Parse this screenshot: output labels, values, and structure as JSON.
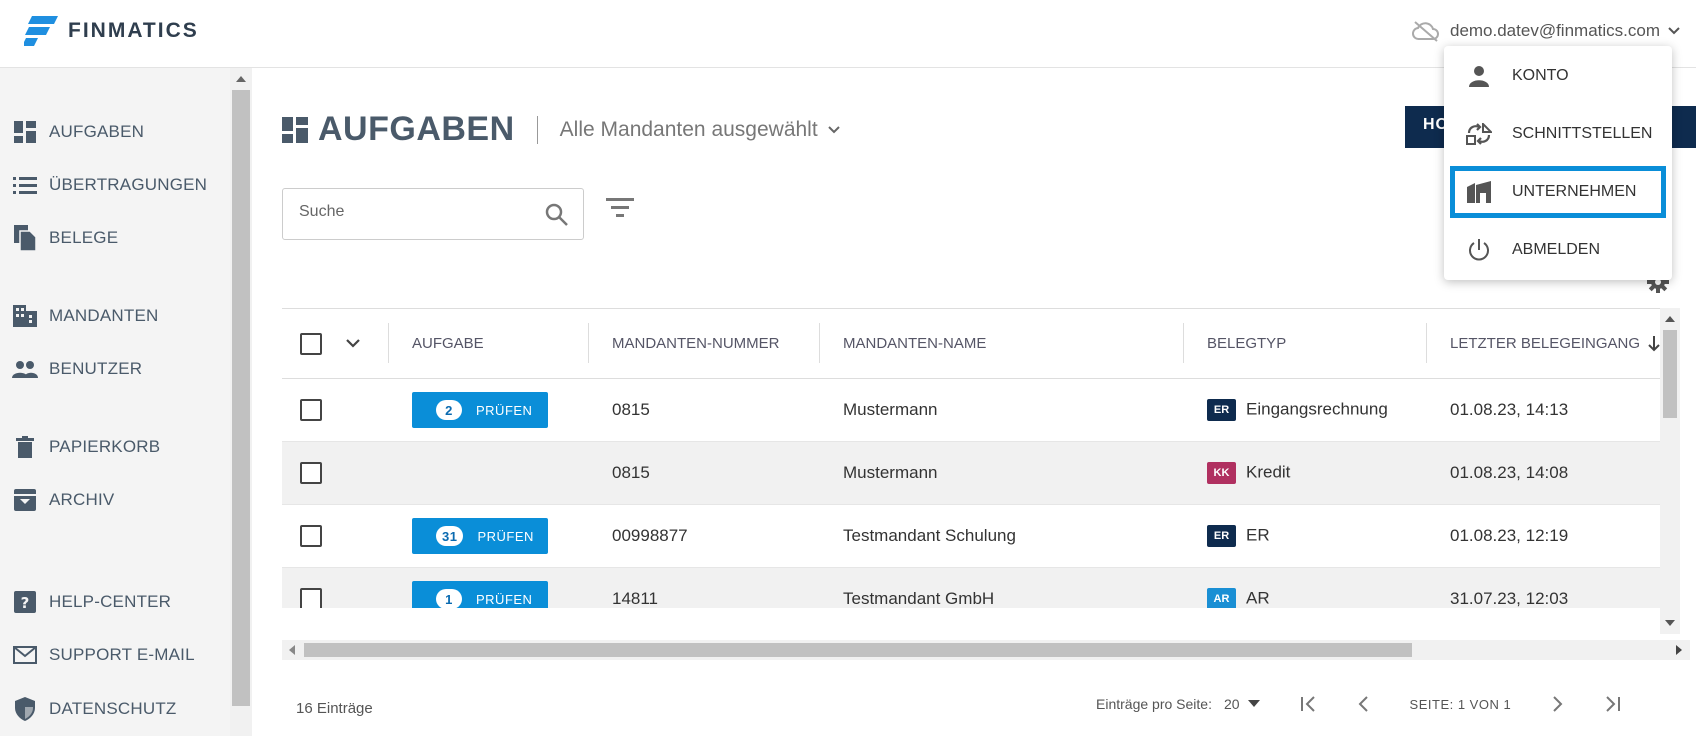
{
  "app": {
    "logo_text": "FINMATICS"
  },
  "user": {
    "email": "demo.datev@finmatics.com"
  },
  "sidebar": {
    "items": [
      {
        "label": "AUFGABEN",
        "icon": "dashboard-icon"
      },
      {
        "label": "ÜBERTRAGUNGEN",
        "icon": "list-icon"
      },
      {
        "label": "BELEGE",
        "icon": "document-copy-icon"
      },
      {
        "label": "MANDANTEN",
        "icon": "building-icon"
      },
      {
        "label": "BENUTZER",
        "icon": "people-icon"
      },
      {
        "label": "PAPIERKORB",
        "icon": "trash-icon"
      },
      {
        "label": "ARCHIV",
        "icon": "archive-icon"
      },
      {
        "label": "HELP-CENTER",
        "icon": "help-icon"
      },
      {
        "label": "SUPPORT E-MAIL",
        "icon": "mail-icon"
      },
      {
        "label": "DATENSCHUTZ",
        "icon": "shield-icon"
      }
    ]
  },
  "header": {
    "title": "AUFGABEN",
    "mandant_select": "Alle Mandanten ausgewählt",
    "primary_button": "HO"
  },
  "search": {
    "placeholder": "Suche"
  },
  "table": {
    "columns": [
      "AUFGABE",
      "MANDANTEN-NUMMER",
      "MANDANTEN-NAME",
      "BELEGTYP",
      "LETZTER BELEGEINGANG"
    ],
    "action_label": "PRÜFEN",
    "rows": [
      {
        "count": "2",
        "number": "0815",
        "name": "Mustermann",
        "tag": "ER",
        "tag_color": "#0e2b4e",
        "type": "Eingangsrechnung",
        "date": "01.08.23, 14:13"
      },
      {
        "count": "",
        "number": "0815",
        "name": "Mustermann",
        "tag": "KK",
        "tag_color": "#b03060",
        "type": "Kredit",
        "date": "01.08.23, 14:08"
      },
      {
        "count": "31",
        "number": "00998877",
        "name": "Testmandant Schulung",
        "tag": "ER",
        "tag_color": "#0e2b4e",
        "type": "ER",
        "date": "01.08.23, 12:19"
      },
      {
        "count": "1",
        "number": "14811",
        "name": "Testmandant GmbH",
        "tag": "AR",
        "tag_color": "#1a8fd4",
        "type": "AR",
        "date": "31.07.23, 12:03"
      }
    ]
  },
  "footer": {
    "entries": "16 Einträge",
    "per_page_label": "Einträge pro Seite:",
    "per_page_value": "20",
    "page_text": "SEITE: 1 VON 1"
  },
  "user_menu": {
    "items": [
      {
        "label": "KONTO",
        "icon": "person-icon"
      },
      {
        "label": "SCHNITTSTELLEN",
        "icon": "interface-icon"
      },
      {
        "label": "UNTERNEHMEN",
        "icon": "company-icon",
        "active": true
      },
      {
        "label": "ABMELDEN",
        "icon": "power-icon"
      }
    ]
  },
  "colors": {
    "accent": "#0a8ed8",
    "navy": "#0e2b4e",
    "nav_text": "#4a5a6a"
  }
}
